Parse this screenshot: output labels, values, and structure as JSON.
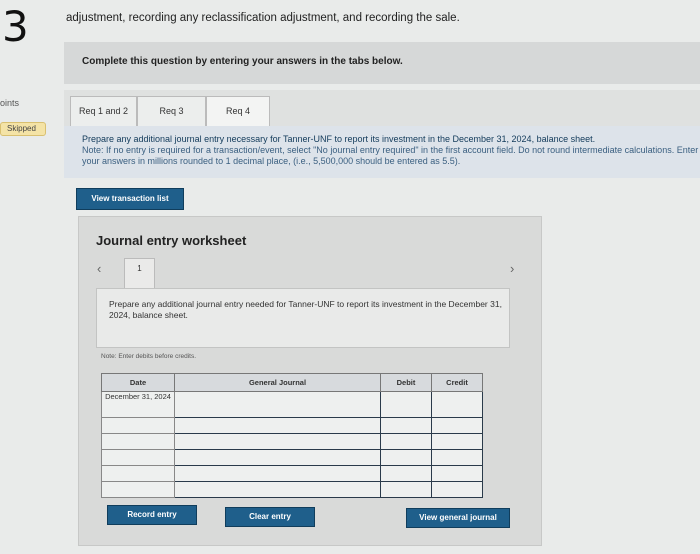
{
  "question": {
    "number": "3",
    "points_label": "oints",
    "status_badge": "Skipped",
    "text": "adjustment, recording any reclassification adjustment, and recording the sale."
  },
  "instruction": "Complete this question by entering your answers in the tabs below.",
  "tabs": [
    {
      "label": "Req 1 and 2"
    },
    {
      "label": "Req 3"
    },
    {
      "label": "Req 4"
    }
  ],
  "prompt": {
    "main": "Prepare any additional journal entry necessary for Tanner-UNF to report its investment in the December 31, 2024, balance sheet.",
    "note": "Note: If no entry is required for a transaction/event, select \"No journal entry required\" in the first account field. Do not round intermediate calculations. Enter your answers in millions rounded to 1 decimal place, (i.e., 5,500,000 should be entered as 5.5)."
  },
  "buttons": {
    "view_transactions": "View transaction list",
    "record_entry": "Record entry",
    "clear_entry": "Clear entry",
    "view_general_journal": "View general journal"
  },
  "worksheet": {
    "title": "Journal entry worksheet",
    "page": "1",
    "entry_description": "Prepare any additional journal entry needed for Tanner-UNF to report its investment in the December 31, 2024, balance sheet.",
    "note": "Note: Enter debits before credits."
  },
  "table": {
    "headers": {
      "date": "Date",
      "journal": "General Journal",
      "debit": "Debit",
      "credit": "Credit"
    },
    "rows": [
      {
        "date": "December 31, 2024",
        "journal": "",
        "debit": "",
        "credit": ""
      },
      {
        "date": "",
        "journal": "",
        "debit": "",
        "credit": ""
      },
      {
        "date": "",
        "journal": "",
        "debit": "",
        "credit": ""
      },
      {
        "date": "",
        "journal": "",
        "debit": "",
        "credit": ""
      },
      {
        "date": "",
        "journal": "",
        "debit": "",
        "credit": ""
      },
      {
        "date": "",
        "journal": "",
        "debit": "",
        "credit": ""
      }
    ]
  }
}
